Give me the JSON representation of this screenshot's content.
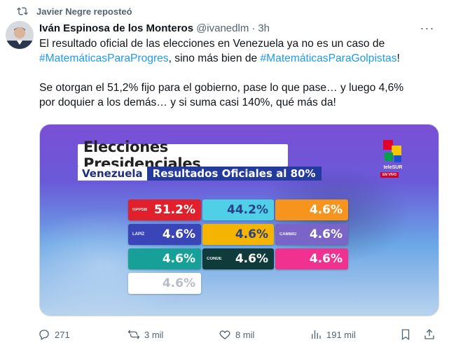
{
  "repost": {
    "label": "Javier Negre reposteó",
    "icon": "repost-icon"
  },
  "author": {
    "name": "Iván Espinosa de los Monteros",
    "handle": "@ivanedlm",
    "separator": "·",
    "time": "3h"
  },
  "more_icon": "more-icon",
  "tweet": {
    "line1": "El resultado oficial de las elecciones en Venezuela ya no es un caso de",
    "hashtag1": "#MatemáticasParaProgres",
    "mid": ", sino más bien de ",
    "hashtag2": "#MatemáticasParaGolpistas",
    "end": "!",
    "para2_line1": "Se otorgan el 51,2% fijo para el gobierno, pase lo que pase… y luego 4,6%",
    "para2_line2": "por doquier a los demás… y si suma casi 140%, qué más da!"
  },
  "media": {
    "title": "Elecciones Presidenciales",
    "country": "Venezuela",
    "results": "Resultados Oficiales al 80%",
    "broadcaster": "teleSUR",
    "live": "EN VIVO",
    "cards": [
      {
        "tag": "GPPSB",
        "value": "51.2%",
        "color": "#e2202b"
      },
      {
        "tag": "",
        "value": "44.2%",
        "color": "#4fd0e6"
      },
      {
        "tag": "",
        "value": "4.6%",
        "color": "#f7941d"
      },
      {
        "tag": "LÁPIZ",
        "value": "4.6%",
        "color": "#3a45b8"
      },
      {
        "tag": "",
        "value": "4.6%",
        "color": "#f4b400"
      },
      {
        "tag": "CAMBIO",
        "value": "4.6%",
        "color": "#7a64c8"
      },
      {
        "tag": "",
        "value": "4.6%",
        "color": "#16a097"
      },
      {
        "tag": "CONDE",
        "value": "4.6%",
        "color": "#0f3b3a"
      },
      {
        "tag": "",
        "value": "4.6%",
        "color": "#f0318f"
      },
      {
        "tag": "",
        "value": "4.6%",
        "color": "#ffffff"
      }
    ]
  },
  "actions": {
    "replies": "271",
    "reposts": "3 mil",
    "likes": "8 mil",
    "views": "191 mil"
  }
}
